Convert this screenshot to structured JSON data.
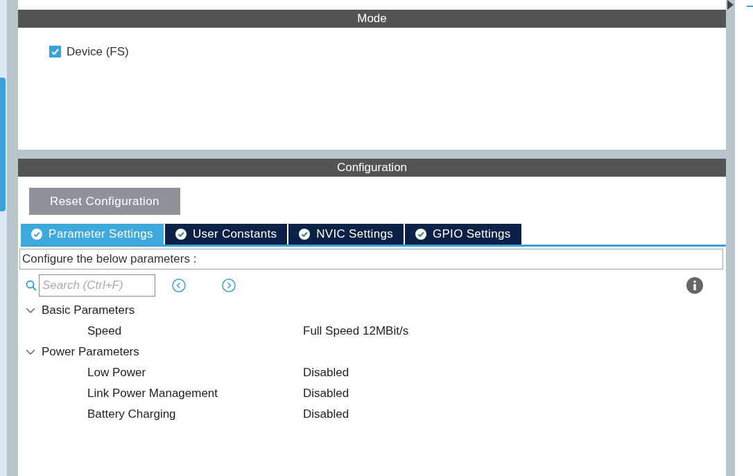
{
  "mode": {
    "title": "Mode",
    "options": [
      {
        "label": "Device (FS)",
        "checked": true
      }
    ]
  },
  "configuration": {
    "title": "Configuration",
    "reset_button": "Reset Configuration",
    "tabs": [
      {
        "label": "Parameter Settings",
        "selected": true
      },
      {
        "label": "User Constants",
        "selected": false
      },
      {
        "label": "NVIC Settings",
        "selected": false
      },
      {
        "label": "GPIO Settings",
        "selected": false
      }
    ],
    "description": "Configure the below parameters :",
    "search": {
      "placeholder": "Search (Ctrl+F)"
    },
    "groups": [
      {
        "name": "Basic Parameters",
        "expanded": true,
        "params": [
          {
            "name": "Speed",
            "value": "Full Speed 12MBit/s"
          }
        ]
      },
      {
        "name": "Power Parameters",
        "expanded": true,
        "params": [
          {
            "name": "Low Power",
            "value": "Disabled"
          },
          {
            "name": "Link Power Management",
            "value": "Disabled"
          },
          {
            "name": "Battery Charging",
            "value": "Disabled"
          }
        ]
      }
    ]
  }
}
